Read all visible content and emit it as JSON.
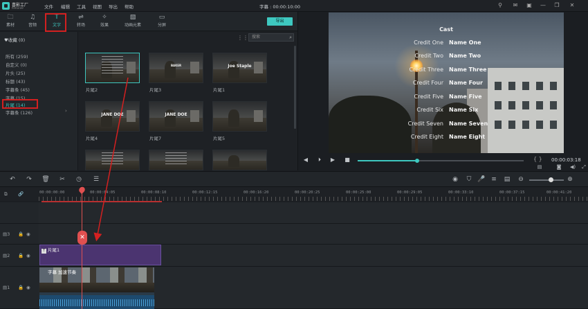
{
  "app": {
    "logo_line1": "喜影工厂",
    "logo_line2": "filmora9",
    "menu": [
      "文件",
      "编辑",
      "工具",
      "视图",
      "导出",
      "帮助"
    ],
    "doc_title": "字幕 : 00:00:10:00",
    "export_label": "导出"
  },
  "tabs": [
    {
      "label": "素材",
      "icon": "folder-icon"
    },
    {
      "label": "音频",
      "icon": "music-icon"
    },
    {
      "label": "文字",
      "icon": "text-icon"
    },
    {
      "label": "转场",
      "icon": "transition-icon"
    },
    {
      "label": "效果",
      "icon": "effects-icon"
    },
    {
      "label": "动画元素",
      "icon": "elements-icon"
    },
    {
      "label": "分屏",
      "icon": "split-screen-icon"
    }
  ],
  "library": {
    "favorites": "♥收藏 (0)",
    "categories": [
      "所有 (259)",
      "自定义 (0)",
      "片头 (25)",
      "标题 (43)",
      "字幕条 (45)",
      "字幕 (15)",
      "片尾 (14)",
      "字幕条 (126)"
    ],
    "selected_index": 6
  },
  "search": {
    "placeholder": "搜索"
  },
  "thumbnails": [
    {
      "label": "片尾2",
      "caption": "",
      "style": "lines"
    },
    {
      "label": "片尾3",
      "caption": "",
      "style": "small"
    },
    {
      "label": "片尾1",
      "caption": "Joe Staple",
      "style": "caption"
    },
    {
      "label": "片尾4",
      "caption": "JANE DOE",
      "style": "caption"
    },
    {
      "label": "片尾7",
      "caption": "JANE DOE",
      "style": "caption"
    },
    {
      "label": "片尾5",
      "caption": "",
      "style": "plain"
    },
    {
      "label": "",
      "caption": "",
      "style": "lines"
    },
    {
      "label": "",
      "caption": "",
      "style": "lines"
    },
    {
      "label": "",
      "caption": "",
      "style": "plain"
    }
  ],
  "preview": {
    "title": "Cast",
    "credits": [
      {
        "role": "Credit One",
        "name": "Name One"
      },
      {
        "role": "Credit Two",
        "name": "Name Two"
      },
      {
        "role": "Credit Three",
        "name": "Name Three"
      },
      {
        "role": "Credit Four",
        "name": "Name Four"
      },
      {
        "role": "Credit Five",
        "name": "Name Five"
      },
      {
        "role": "Credit Six",
        "name": "Name Six"
      },
      {
        "role": "Credit Seven",
        "name": "Name Seven"
      },
      {
        "role": "Credit Eight",
        "name": "Name Eight"
      }
    ],
    "timecode": "00:00:03:18",
    "progress_fraction": 0.36
  },
  "timeline": {
    "ruler_labels": [
      "00:00:00:00",
      "00:00:04:05",
      "00:00:08:10",
      "00:00:12:15",
      "00:00:16:20",
      "00:00:20:25",
      "00:00:25:00",
      "00:00:29:05",
      "00:00:33:10",
      "00:00:37:15",
      "00:00:41:20"
    ],
    "tracks": [
      "3",
      "2",
      "1"
    ],
    "text_clip_label": "片尾1",
    "video_clip_label": "字幕 加速节奏",
    "zoom_fraction": 0.62
  },
  "colors": {
    "accent": "#3ec8c0",
    "annotation": "#d42020",
    "text_clip": "#4b3470"
  }
}
